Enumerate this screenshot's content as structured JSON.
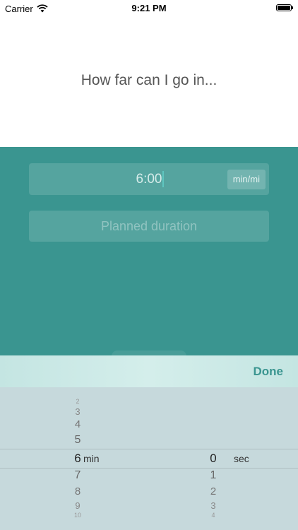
{
  "status_bar": {
    "carrier": "Carrier",
    "time": "9:21 PM",
    "icons": [
      "wifi-icon",
      "battery-icon"
    ]
  },
  "question": "How far can I go in...",
  "pace": {
    "value": "6:00",
    "unit": "min/mi"
  },
  "duration": {
    "placeholder": "Planned duration"
  },
  "toolbar": {
    "done_label": "Done"
  },
  "picker": {
    "minutes": {
      "above": [
        "2",
        "3",
        "4",
        "5"
      ],
      "selected": "6",
      "below": [
        "7",
        "8",
        "9",
        "10"
      ],
      "unit": "min"
    },
    "seconds": {
      "selected": "0",
      "below": [
        "1",
        "2",
        "3",
        "4"
      ],
      "unit": "sec"
    }
  },
  "colors": {
    "teal": "#3a9590",
    "picker_bg": "#c6d9dc",
    "toolbar_bg": "#cbe9e6",
    "done": "#3a9590"
  }
}
